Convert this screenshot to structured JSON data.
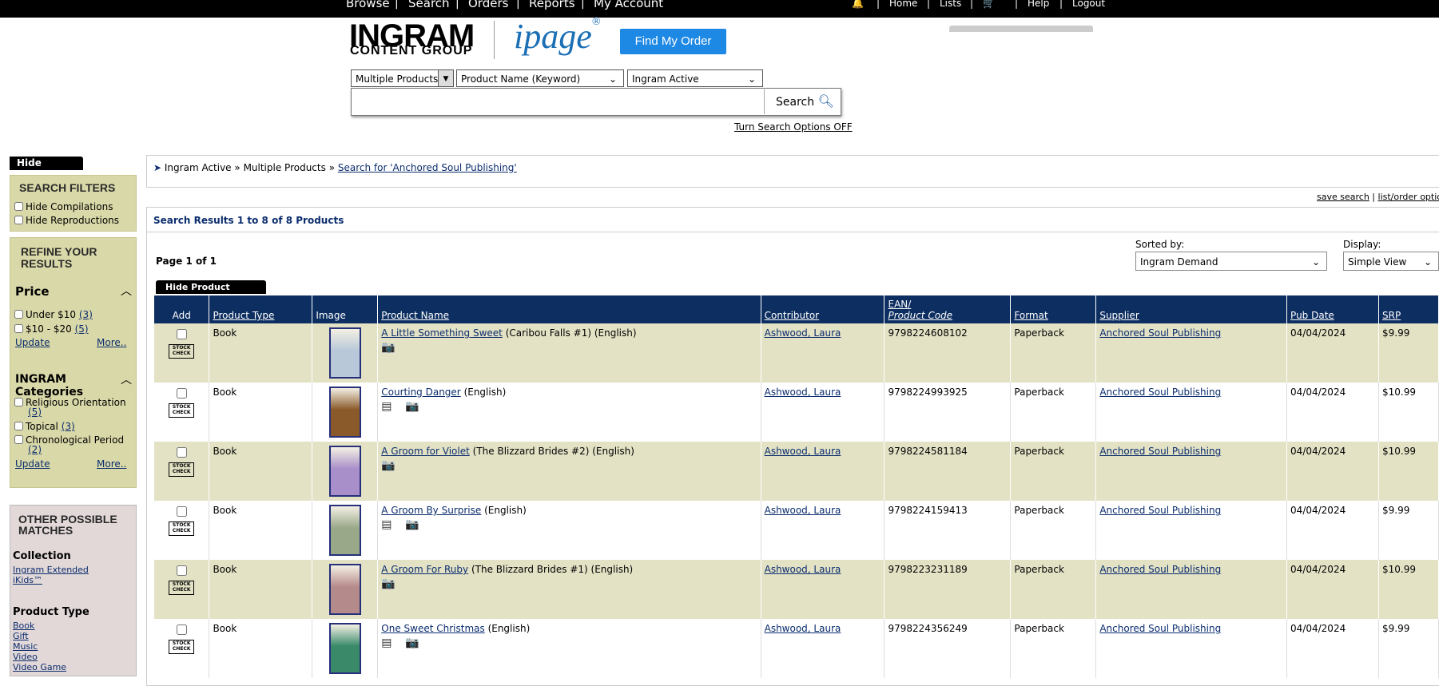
{
  "topnav": {
    "browse": "Browse",
    "search": "Search",
    "orders": "Orders",
    "reports": "Reports",
    "my_account": "My Account",
    "home": "Home",
    "lists": "Lists",
    "help": "Help",
    "logout": "Logout",
    "sep": "|"
  },
  "header": {
    "logo_ingram": "INGRAM",
    "logo_content_group": "CONTENT GROUP",
    "logo_ipage": "ipage",
    "find_order": "Find My Order"
  },
  "search": {
    "product_scope": "Multiple Products",
    "field": "Product Name (Keyword)",
    "status": "Ingram Active",
    "query": "",
    "button": "Search",
    "turn_off": "Turn Search Options OFF"
  },
  "sidebar": {
    "hide_options": "Hide Options",
    "search_filters_title": "SEARCH FILTERS",
    "filters": [
      "Hide Compilations",
      "Hide Reproductions"
    ],
    "refine_title_1": "REFINE YOUR",
    "refine_title_2": "RESULTS",
    "price_title": "Price",
    "price_items": [
      {
        "label": "Under $10",
        "count": "(3)"
      },
      {
        "label": "$10 - $20",
        "count": "(5)"
      }
    ],
    "update": "Update",
    "more": "More..",
    "cat_title": "INGRAM Categories",
    "cat_items": [
      {
        "label": "Religious Orientation",
        "count": "(5)"
      },
      {
        "label": "Topical",
        "count": "(3)"
      },
      {
        "label": "Chronological Period",
        "count": "(2)"
      }
    ],
    "other_title_1": "OTHER POSSIBLE",
    "other_title_2": "MATCHES",
    "collection_title": "Collection",
    "collection_links": [
      "Ingram Extended",
      "iKids™"
    ],
    "ptype_title": "Product Type",
    "ptype_links": [
      "Book",
      "Gift",
      "Music",
      "Video",
      "Video Game"
    ]
  },
  "breadcrumb": {
    "arrow": "➤",
    "item1": "Ingram Active",
    "sep": "»",
    "item2": "Multiple Products",
    "item3": "Search for 'Anchored Soul Publishing'"
  },
  "actions": {
    "save_search": "save search",
    "sep": "|",
    "list_options": "list/order options"
  },
  "results": {
    "title": "Search Results 1 to 8 of 8 Products",
    "page": "Page 1 of 1",
    "sorted_label": "Sorted by:",
    "sorted_value": "Ingram Demand",
    "display_label": "Display:",
    "display_value": "Simple View",
    "hide_images": "Hide Product Images"
  },
  "columns": {
    "add": "Add",
    "type": "Product Type",
    "image": "Image",
    "name": "Product Name",
    "contributor": "Contributor",
    "ean1": "EAN/",
    "ean2": "Product Code",
    "format": "Format",
    "supplier": "Supplier",
    "pubdate": "Pub Date",
    "srp": "SRP"
  },
  "stock_check": "STOCK CHECK",
  "rows": [
    {
      "type": "Book",
      "title": "A Little Something Sweet",
      "suffix": "(Caribou Falls #1) (English)",
      "contributor": "Ashwood, Laura",
      "ean": "9798224608102",
      "format": "Paperback",
      "supplier": "Anchored Soul Publishing",
      "pubdate": "04/04/2024",
      "srp": "$9.99",
      "icons": "📷",
      "cover": "#b8c8d8"
    },
    {
      "type": "Book",
      "title": "Courting Danger",
      "suffix": "(English)",
      "contributor": "Ashwood, Laura",
      "ean": "9798224993925",
      "format": "Paperback",
      "supplier": "Anchored Soul Publishing",
      "pubdate": "04/04/2024",
      "srp": "$10.99",
      "icons": "▤ 📷",
      "cover": "#8a5a2a"
    },
    {
      "type": "Book",
      "title": "A Groom for Violet",
      "suffix": "(The Blizzard Brides #2) (English)",
      "contributor": "Ashwood, Laura",
      "ean": "9798224581184",
      "format": "Paperback",
      "supplier": "Anchored Soul Publishing",
      "pubdate": "04/04/2024",
      "srp": "$10.99",
      "icons": "📷",
      "cover": "#a98fc9"
    },
    {
      "type": "Book",
      "title": "A Groom By Surprise",
      "suffix": "(English)",
      "contributor": "Ashwood, Laura",
      "ean": "9798224159413",
      "format": "Paperback",
      "supplier": "Anchored Soul Publishing",
      "pubdate": "04/04/2024",
      "srp": "$9.99",
      "icons": "▤ 📷",
      "cover": "#9aa88a"
    },
    {
      "type": "Book",
      "title": "A Groom For Ruby",
      "suffix": "(The Blizzard Brides #1) (English)",
      "contributor": "Ashwood, Laura",
      "ean": "9798223231189",
      "format": "Paperback",
      "supplier": "Anchored Soul Publishing",
      "pubdate": "04/04/2024",
      "srp": "$10.99",
      "icons": "📷",
      "cover": "#b58a8a"
    },
    {
      "type": "Book",
      "title": "One Sweet Christmas",
      "suffix": "(English)",
      "contributor": "Ashwood, Laura",
      "ean": "9798224356249",
      "format": "Paperback",
      "supplier": "Anchored Soul Publishing",
      "pubdate": "04/04/2024",
      "srp": "$9.99",
      "icons": "▤ 📷",
      "cover": "#3a8a6a"
    }
  ]
}
